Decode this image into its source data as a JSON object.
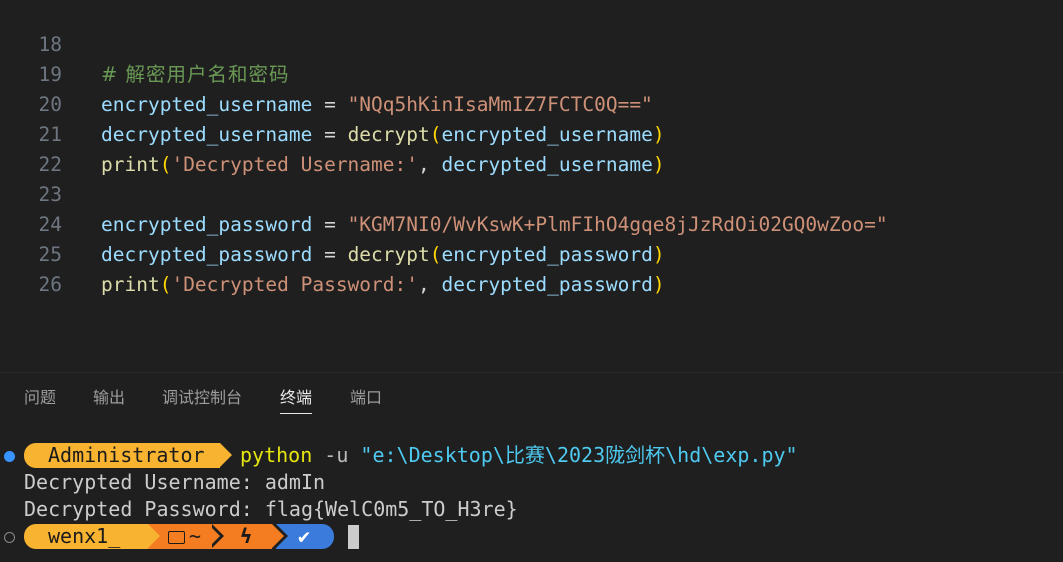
{
  "editor": {
    "lines": [
      {
        "num": "18",
        "comment": "# 解密用户名和密码"
      },
      {
        "num": "19",
        "var": "encrypted_username",
        "op": " = ",
        "str": "\"NQq5hKinIsaMmIZ7FCTC0Q==\""
      },
      {
        "num": "20",
        "var": "decrypted_username",
        "op": " = ",
        "fn": "decrypt",
        "open": "(",
        "arg": "encrypted_username",
        "close": ")"
      },
      {
        "num": "21",
        "fn": "print",
        "open": "(",
        "str": "'Decrypted Username:'",
        "sep": ", ",
        "arg": "decrypted_username",
        "close": ")"
      },
      {
        "num": "22"
      },
      {
        "num": "23",
        "var": "encrypted_password",
        "op": " = ",
        "str": "\"KGM7NI0/WvKswK+PlmFIhO4gqe8jJzRdOi02GQ0wZoo=\""
      },
      {
        "num": "24",
        "var": "decrypted_password",
        "op": " = ",
        "fn": "decrypt",
        "open": "(",
        "arg": "encrypted_password",
        "close": ")"
      },
      {
        "num": "25",
        "fn": "print",
        "open": "(",
        "str": "'Decrypted Password:'",
        "sep": ", ",
        "arg": "decrypted_password",
        "close": ")"
      },
      {
        "num": "26"
      }
    ]
  },
  "panel": {
    "tabs": [
      "问题",
      "输出",
      "调试控制台",
      "终端",
      "端口"
    ],
    "active_tab": "终端"
  },
  "terminal": {
    "prompt_user": "Administrator",
    "command": "python",
    "flag": " -u ",
    "path": "\"e:\\Desktop\\比赛\\2023陇剑杯\\hd\\exp.py\"",
    "output": [
      "Decrypted Username: admIn",
      "Decrypted Password: flag{WelC0m5_TO_H3re}"
    ],
    "prompt2_user": "wenx1_",
    "prompt2_dir": "~",
    "prompt2_bolt": "ϟ",
    "prompt2_ok": "✔"
  },
  "colors": {
    "background": "#1f1f1f",
    "prompt_yellow": "#f8b331",
    "prompt_orange": "#f47d22",
    "prompt_blue": "#3b7bdc",
    "string": "#ce9178",
    "variable": "#9cdcfe",
    "function": "#dcdcaa",
    "comment": "#6a9955"
  }
}
